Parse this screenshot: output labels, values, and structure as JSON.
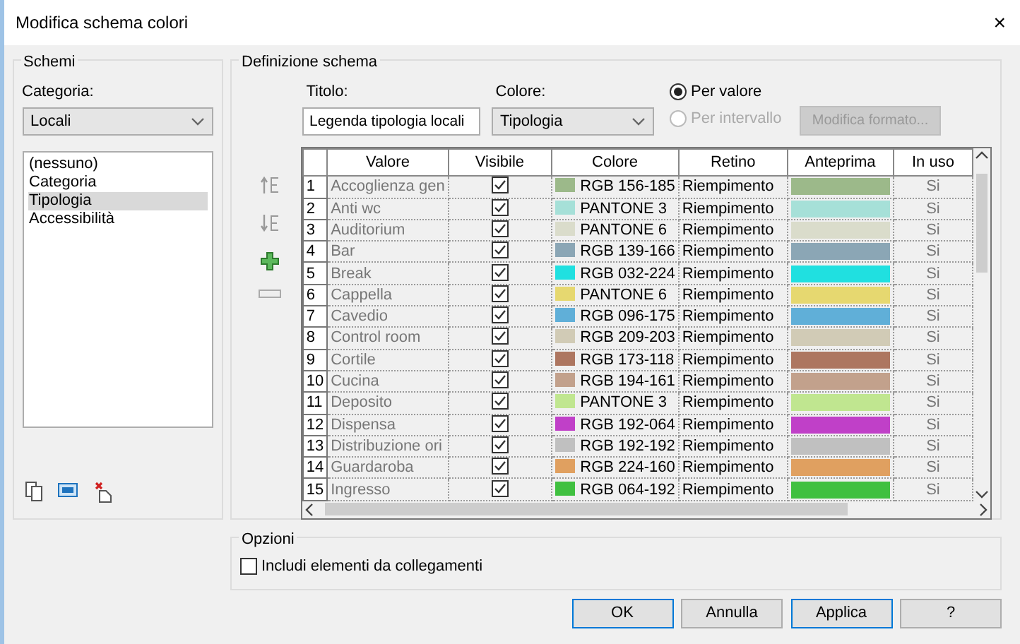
{
  "window": {
    "title": "Modifica schema colori",
    "close": "×"
  },
  "schemes": {
    "group_label": "Schemi",
    "category_label": "Categoria:",
    "category_value": "Locali",
    "items": [
      {
        "label": "(nessuno)",
        "selected": false
      },
      {
        "label": "Categoria",
        "selected": false
      },
      {
        "label": "Tipologia",
        "selected": true
      },
      {
        "label": "Accessibilità",
        "selected": false
      }
    ]
  },
  "definition": {
    "group_label": "Definizione schema",
    "title_label": "Titolo:",
    "title_value": "Legenda tipologia locali",
    "color_label": "Colore:",
    "color_value": "Tipologia",
    "modes": [
      {
        "label": "Per valore",
        "selected": true,
        "disabled": false
      },
      {
        "label": "Per intervallo",
        "selected": false,
        "disabled": true
      }
    ],
    "format_button": {
      "label": "Modifica formato...",
      "disabled": true
    },
    "columns": [
      "Valore",
      "Visibile",
      "Colore",
      "Retino",
      "Anteprima",
      "In uso"
    ],
    "rows": [
      {
        "number": "1",
        "value": "Accoglienza gen",
        "visible": true,
        "color": "#9cb98a",
        "color_name": "RGB 156-185",
        "pattern": "Riempimento",
        "in_use": "Si"
      },
      {
        "number": "2",
        "value": "Anti wc",
        "visible": true,
        "color": "#a6e0d8",
        "color_name": "PANTONE 3",
        "pattern": "Riempimento",
        "in_use": "Si"
      },
      {
        "number": "3",
        "value": "Auditorium",
        "visible": true,
        "color": "#dadccb",
        "color_name": "PANTONE 6",
        "pattern": "Riempimento",
        "in_use": "Si"
      },
      {
        "number": "4",
        "value": "Bar",
        "visible": true,
        "color": "#8ba6b5",
        "color_name": "RGB 139-166",
        "pattern": "Riempimento",
        "in_use": "Si"
      },
      {
        "number": "5",
        "value": "Break",
        "visible": true,
        "color": "#20e0e0",
        "color_name": "RGB 032-224",
        "pattern": "Riempimento",
        "in_use": "Si"
      },
      {
        "number": "6",
        "value": "Cappella",
        "visible": true,
        "color": "#e6d870",
        "color_name": "PANTONE 6",
        "pattern": "Riempimento",
        "in_use": "Si"
      },
      {
        "number": "7",
        "value": "Cavedio",
        "visible": true,
        "color": "#60afd8",
        "color_name": "RGB 096-175",
        "pattern": "Riempimento",
        "in_use": "Si"
      },
      {
        "number": "8",
        "value": "Control room",
        "visible": true,
        "color": "#d1cbb6",
        "color_name": "RGB 209-203",
        "pattern": "Riempimento",
        "in_use": "Si"
      },
      {
        "number": "9",
        "value": "Cortile",
        "visible": true,
        "color": "#ad7660",
        "color_name": "RGB 173-118",
        "pattern": "Riempimento",
        "in_use": "Si"
      },
      {
        "number": "10",
        "value": "Cucina",
        "visible": true,
        "color": "#c2a18c",
        "color_name": "RGB 194-161",
        "pattern": "Riempimento",
        "in_use": "Si"
      },
      {
        "number": "11",
        "value": "Deposito",
        "visible": true,
        "color": "#c0e690",
        "color_name": "PANTONE 3",
        "pattern": "Riempimento",
        "in_use": "Si"
      },
      {
        "number": "12",
        "value": "Dispensa",
        "visible": true,
        "color": "#c040c8",
        "color_name": "RGB 192-064",
        "pattern": "Riempimento",
        "in_use": "Si"
      },
      {
        "number": "13",
        "value": "Distribuzione ori",
        "visible": true,
        "color": "#c0c0c0",
        "color_name": "RGB 192-192",
        "pattern": "Riempimento",
        "in_use": "Si"
      },
      {
        "number": "14",
        "value": "Guardaroba",
        "visible": true,
        "color": "#e0a060",
        "color_name": "RGB 224-160",
        "pattern": "Riempimento",
        "in_use": "Si"
      },
      {
        "number": "15",
        "value": "Ingresso",
        "visible": true,
        "color": "#40c040",
        "color_name": "RGB 064-192",
        "pattern": "Riempimento",
        "in_use": "Si"
      }
    ]
  },
  "options": {
    "group_label": "Opzioni",
    "include_links": {
      "label": "Includi elementi da collegamenti",
      "checked": false
    }
  },
  "buttons": [
    {
      "label": "OK",
      "highlighted": true
    },
    {
      "label": "Annulla",
      "highlighted": false
    },
    {
      "label": "Applica",
      "highlighted": true
    },
    {
      "label": "?",
      "highlighted": false
    }
  ]
}
